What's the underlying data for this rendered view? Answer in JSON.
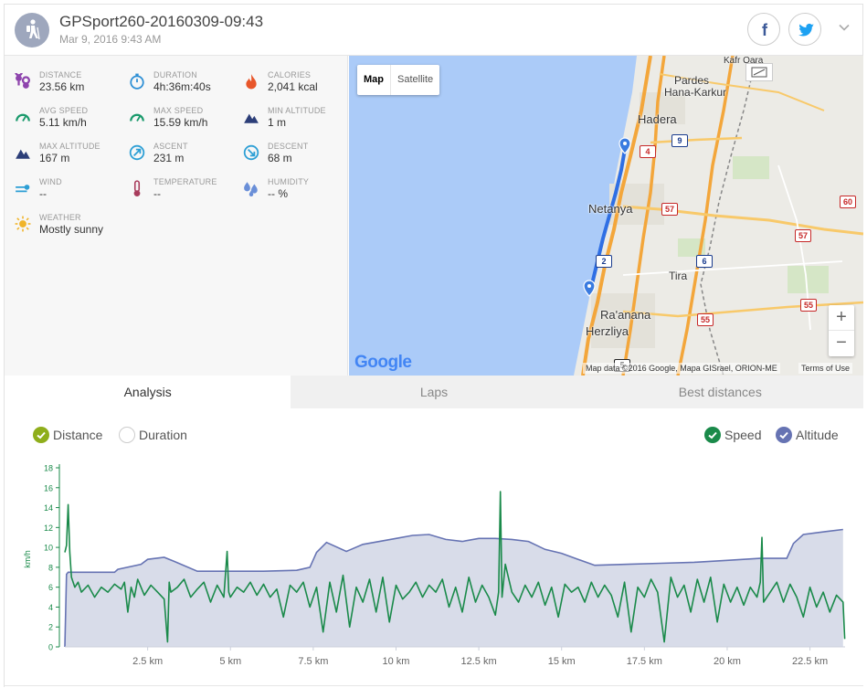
{
  "header": {
    "title": "GPSport260-20160309-09:43",
    "subtitle": "Mar 9, 2016 9:43 AM",
    "facebook_icon": "f",
    "colors": {
      "facebook": "#3b5998",
      "twitter": "#1da1f2",
      "avatar": "#9ea7bd"
    }
  },
  "stats": [
    {
      "key": "distance",
      "label": "DISTANCE",
      "value": "23.56 km",
      "icon": "route-icon",
      "color": "#8e44ad"
    },
    {
      "key": "duration",
      "label": "DURATION",
      "value": "4h:36m:40s",
      "icon": "stopwatch-icon",
      "color": "#2d8fd5"
    },
    {
      "key": "calories",
      "label": "CALORIES",
      "value": "2,041 kcal",
      "icon": "flame-icon",
      "color": "#e8562a"
    },
    {
      "key": "avg_speed",
      "label": "AVG SPEED",
      "value": "5.11 km/h",
      "icon": "speedometer-icon",
      "color": "#1a9a6c"
    },
    {
      "key": "max_speed",
      "label": "MAX SPEED",
      "value": "15.59 km/h",
      "icon": "speedometer-icon",
      "color": "#1a9a6c"
    },
    {
      "key": "min_altitude",
      "label": "MIN ALTITUDE",
      "value": "1 m",
      "icon": "mountain-icon",
      "color": "#2c3e78"
    },
    {
      "key": "max_altitude",
      "label": "MAX ALTITUDE",
      "value": "167 m",
      "icon": "mountain-icon",
      "color": "#2c3e78"
    },
    {
      "key": "ascent",
      "label": "ASCENT",
      "value": "231 m",
      "icon": "ascent-icon",
      "color": "#2d9fd5"
    },
    {
      "key": "descent",
      "label": "DESCENT",
      "value": "68 m",
      "icon": "descent-icon",
      "color": "#2d9fd5"
    },
    {
      "key": "wind",
      "label": "WIND",
      "value": "--",
      "icon": "wind-icon",
      "color": "#2d9fd5"
    },
    {
      "key": "temperature",
      "label": "TEMPERATURE",
      "value": "--",
      "icon": "thermometer-icon",
      "color": "#a83c5c"
    },
    {
      "key": "humidity",
      "label": "HUMIDITY",
      "value": "-- %",
      "icon": "droplets-icon",
      "color": "#6a8fd8"
    },
    {
      "key": "weather",
      "label": "WEATHER",
      "value": "Mostly sunny",
      "icon": "sun-icon",
      "color": "#f0b429"
    }
  ],
  "map": {
    "map_button": "Map",
    "satellite_button": "Satellite",
    "zoom_in": "+",
    "zoom_out": "−",
    "google_logo": "Google",
    "attribution": "Map data ©2016 Google, Mapa GISrael, ORION-ME",
    "terms": "Terms of Use",
    "cities": [
      {
        "name": "Pardes",
        "big": false
      },
      {
        "name": "Hana-Karkur",
        "big": false
      },
      {
        "name": "Hadera",
        "big": true
      },
      {
        "name": "Netanya",
        "big": true
      },
      {
        "name": "Tira",
        "big": false
      },
      {
        "name": "Ra'anana",
        "big": true
      },
      {
        "name": "Herzliya",
        "big": true
      },
      {
        "name": "Kafr Qara",
        "big": false
      }
    ],
    "shields": [
      {
        "text": "4",
        "style": "red"
      },
      {
        "text": "9",
        "style": "blue"
      },
      {
        "text": "57",
        "style": "red"
      },
      {
        "text": "2",
        "style": "blue"
      },
      {
        "text": "6",
        "style": "blue"
      },
      {
        "text": "57",
        "style": "red"
      },
      {
        "text": "60",
        "style": "red"
      },
      {
        "text": "55",
        "style": "red"
      },
      {
        "text": "55",
        "style": "red"
      },
      {
        "text": "5",
        "style": "black"
      }
    ],
    "colors": {
      "sea": "#abcbf8",
      "land": "#ecebe6",
      "highway": "#f3a63b",
      "track": "#2f6fe4"
    }
  },
  "tabs": [
    {
      "label": "Analysis",
      "active": true
    },
    {
      "label": "Laps",
      "active": false
    },
    {
      "label": "Best distances",
      "active": false
    }
  ],
  "toggles": {
    "distance": {
      "label": "Distance",
      "checked": true,
      "color": "#8fae1b"
    },
    "duration": {
      "label": "Duration",
      "checked": false
    },
    "speed": {
      "label": "Speed",
      "checked": true,
      "color": "#1a8a4a"
    },
    "altitude": {
      "label": "Altitude",
      "checked": true,
      "color": "#6673b3"
    }
  },
  "chart_data": {
    "type": "line",
    "ylabel": "km/h",
    "ylim": [
      0,
      18
    ],
    "yticks": [
      0,
      2,
      4,
      6,
      8,
      10,
      12,
      14,
      16,
      18
    ],
    "xlim": [
      0,
      23.56
    ],
    "xticks": [
      {
        "value": 2.5,
        "label": "2.5 km"
      },
      {
        "value": 5,
        "label": "5 km"
      },
      {
        "value": 7.5,
        "label": "7.5 km"
      },
      {
        "value": 10,
        "label": "10 km"
      },
      {
        "value": 12.5,
        "label": "12.5 km"
      },
      {
        "value": 15,
        "label": "15 km"
      },
      {
        "value": 17.5,
        "label": "17.5 km"
      },
      {
        "value": 20,
        "label": "20 km"
      },
      {
        "value": 22.5,
        "label": "22.5 km"
      }
    ],
    "grid": false,
    "series": [
      {
        "name": "Altitude",
        "kind": "area",
        "color": "#6673b3",
        "fill": "#d8dce9",
        "x": [
          0,
          0.05,
          0.1,
          1.5,
          1.6,
          2.3,
          2.5,
          3.0,
          3.3,
          4.0,
          4.5,
          5.0,
          6.0,
          7.0,
          7.4,
          7.6,
          7.9,
          8.5,
          9.0,
          9.5,
          10.0,
          10.5,
          11.0,
          11.5,
          12.0,
          12.5,
          13.0,
          13.5,
          14.0,
          14.5,
          15.0,
          15.5,
          16.0,
          17.0,
          18.0,
          19.0,
          20.0,
          21.0,
          21.8,
          22.0,
          22.3,
          23.0,
          23.5
        ],
        "y": [
          0,
          7.3,
          7.5,
          7.5,
          7.8,
          8.3,
          8.8,
          9.0,
          8.6,
          7.6,
          7.6,
          7.6,
          7.6,
          7.7,
          8.0,
          9.5,
          10.5,
          9.6,
          10.3,
          10.6,
          10.9,
          11.2,
          11.3,
          10.8,
          10.6,
          10.9,
          10.9,
          10.8,
          10.6,
          9.8,
          9.4,
          8.8,
          8.2,
          8.3,
          8.4,
          8.5,
          8.7,
          8.9,
          8.9,
          10.4,
          11.3,
          11.6,
          11.8
        ]
      },
      {
        "name": "Speed",
        "kind": "line",
        "color": "#1a8a4a",
        "x": [
          0,
          0.05,
          0.1,
          0.15,
          0.2,
          0.3,
          0.4,
          0.5,
          0.7,
          0.9,
          1.1,
          1.3,
          1.5,
          1.7,
          1.8,
          1.9,
          2.0,
          2.1,
          2.2,
          2.4,
          2.6,
          2.8,
          3.0,
          3.1,
          3.15,
          3.2,
          3.4,
          3.6,
          3.8,
          4.0,
          4.2,
          4.4,
          4.6,
          4.8,
          4.9,
          4.95,
          5.0,
          5.2,
          5.4,
          5.6,
          5.8,
          6.0,
          6.2,
          6.4,
          6.6,
          6.8,
          7.0,
          7.2,
          7.4,
          7.6,
          7.8,
          8.0,
          8.2,
          8.4,
          8.6,
          8.8,
          9.0,
          9.2,
          9.4,
          9.6,
          9.8,
          10.0,
          10.2,
          10.4,
          10.6,
          10.8,
          11.0,
          11.2,
          11.4,
          11.6,
          11.8,
          12.0,
          12.2,
          12.4,
          12.6,
          12.8,
          13.0,
          13.1,
          13.15,
          13.2,
          13.3,
          13.5,
          13.7,
          13.9,
          14.1,
          14.3,
          14.5,
          14.7,
          14.9,
          15.1,
          15.3,
          15.5,
          15.7,
          15.9,
          16.1,
          16.3,
          16.5,
          16.7,
          16.9,
          17.1,
          17.3,
          17.5,
          17.7,
          17.9,
          18.1,
          18.3,
          18.5,
          18.7,
          18.9,
          19.1,
          19.3,
          19.5,
          19.7,
          19.9,
          20.1,
          20.3,
          20.5,
          20.7,
          20.9,
          21.0,
          21.05,
          21.1,
          21.3,
          21.5,
          21.7,
          21.9,
          22.1,
          22.3,
          22.5,
          22.7,
          22.9,
          23.1,
          23.3,
          23.5,
          23.55
        ],
        "y": [
          9.5,
          10.2,
          14.3,
          9.5,
          7.0,
          6.0,
          6.5,
          5.5,
          6.2,
          5.0,
          6.0,
          5.5,
          6.3,
          5.8,
          6.5,
          3.5,
          6.0,
          5.0,
          6.8,
          5.2,
          6.2,
          5.5,
          4.8,
          0.5,
          6.5,
          5.5,
          6.0,
          6.8,
          5.0,
          5.8,
          6.5,
          4.5,
          6.2,
          5.0,
          9.6,
          5.5,
          5.0,
          6.0,
          5.5,
          6.5,
          5.2,
          6.3,
          5.0,
          5.8,
          3.0,
          6.2,
          5.5,
          6.5,
          4.0,
          6.0,
          1.5,
          6.5,
          3.5,
          7.2,
          2.0,
          6.0,
          4.5,
          6.8,
          3.5,
          7.0,
          2.5,
          6.2,
          4.8,
          5.5,
          6.5,
          5.0,
          6.2,
          5.5,
          6.8,
          4.0,
          6.0,
          3.5,
          7.0,
          4.5,
          6.2,
          5.0,
          3.2,
          5.5,
          15.6,
          5.0,
          8.3,
          5.5,
          4.5,
          6.2,
          5.0,
          6.5,
          4.2,
          6.0,
          3.0,
          6.3,
          5.5,
          6.0,
          4.5,
          6.5,
          5.0,
          6.2,
          5.2,
          3.0,
          6.5,
          1.5,
          6.0,
          5.0,
          6.8,
          5.5,
          0.5,
          7.0,
          5.0,
          6.2,
          3.5,
          6.8,
          4.5,
          7.0,
          2.5,
          6.3,
          4.5,
          6.0,
          4.2,
          6.0,
          5.0,
          6.5,
          11.0,
          4.5,
          5.5,
          6.5,
          4.5,
          6.3,
          5.0,
          3.0,
          6.0,
          4.0,
          5.5,
          3.5,
          5.2,
          4.5,
          0.8
        ]
      }
    ]
  }
}
